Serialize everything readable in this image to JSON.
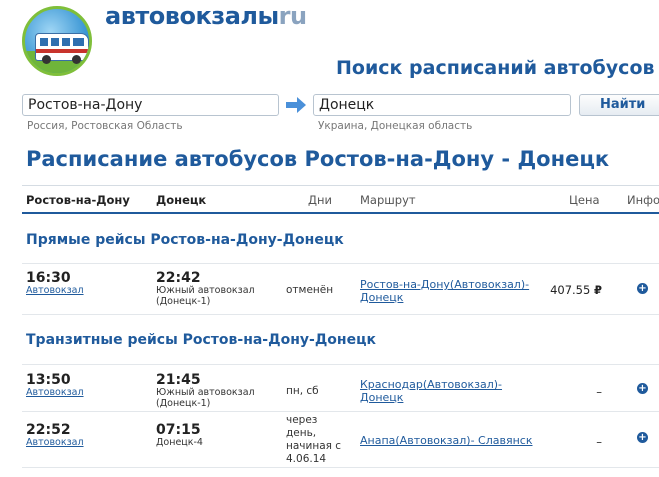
{
  "brand": {
    "name": "автовокзалы",
    "suffix": "ru"
  },
  "search": {
    "heading": "Поиск расписаний автобусов",
    "from_value": "Ростов-на-Дону",
    "from_region": "Россия, Ростовская Область",
    "to_value": "Донецк",
    "to_region": "Украина, Донецкая область",
    "button_label": "Найти"
  },
  "page_title": "Расписание автобусов Ростов-на-Дону - Донецк",
  "table": {
    "headers": {
      "from": "Ростов-на-Дону",
      "to": "Донецк",
      "days": "Дни",
      "route": "Маршрут",
      "price": "Цена",
      "info": "Инфо"
    },
    "sections": [
      {
        "title": "Прямые рейсы Ростов-на-Дону-Донецк"
      },
      {
        "title": "Транзитные рейсы Ростов-на-Дону-Донецк"
      }
    ],
    "rows": [
      {
        "dep_time": "16:30",
        "dep_station": "Автовокзал",
        "arr_time": "22:42",
        "arr_station": "Южный автовокзал (Донецк-1)",
        "days": "отменён",
        "route": "Ростов-на-Дону(Автовокзал)-Донецк",
        "price": "407.55",
        "currency": "₽"
      },
      {
        "dep_time": "13:50",
        "dep_station": "Автовокзал",
        "arr_time": "21:45",
        "arr_station": "Южный автовокзал (Донецк-1)",
        "days": "пн, сб",
        "route": "Краснодар(Автовокзал)-Донецк",
        "price": "–"
      },
      {
        "dep_time": "22:52",
        "dep_station": "Автовокзал",
        "arr_time": "07:15",
        "arr_station": "Донецк-4",
        "days": "через день, начиная с 4.06.14",
        "route": "Анапа(Автовокзал)- Славянск",
        "price": "–"
      }
    ]
  },
  "colors": {
    "brand_blue": "#1f5a9c",
    "arrow_blue": "#4a90d9",
    "logo_green": "#7fbf3a"
  },
  "icons": [
    "bus-logo-icon",
    "arrow-right-icon",
    "info-plus-icon"
  ]
}
